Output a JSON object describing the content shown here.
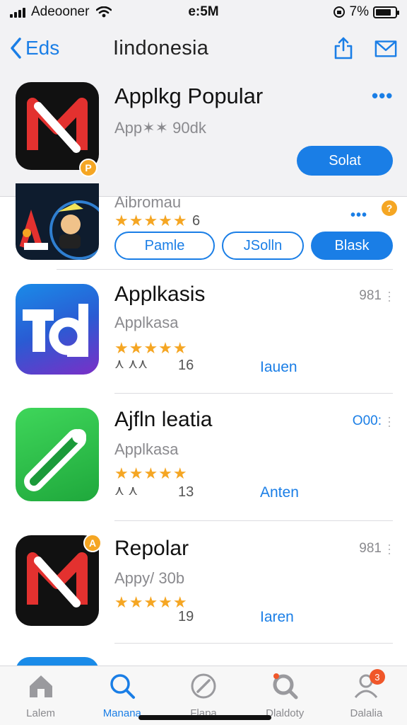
{
  "status": {
    "carrier": "Adeooner",
    "time": "e:5M",
    "battery": "7%",
    "battery_level": 0.8
  },
  "nav": {
    "back_label": "Eds",
    "title": "Iindonesia"
  },
  "featured": {
    "title": "Applkg Popular",
    "subtitle": "App✶✶ 90dk",
    "badge": "P",
    "action_label": "Solat"
  },
  "partial_row": {
    "title": "Aibromau",
    "stars": "★★★★★",
    "count": "6",
    "buttons": [
      "Pamle",
      "JSolln",
      "Blask"
    ],
    "badge": "?"
  },
  "apps": [
    {
      "title": "Applkasis",
      "subtitle": "Applkasa",
      "stars": "★★★★★",
      "meta": "⋏ ⋏⋏",
      "count": "16",
      "link": "Iauen",
      "size": "981"
    },
    {
      "title": "Ajfln leatia",
      "subtitle": "Applkasa",
      "stars": "★★★★★",
      "meta": "⋏ ⋏",
      "count": "13",
      "link": "Anten",
      "size": "O00:"
    },
    {
      "title": "Repolar",
      "subtitle": "Appy/ 30b",
      "stars": "★★★★★",
      "meta": "",
      "count": "19",
      "link": "Iaren",
      "size": "981",
      "badge": "A"
    }
  ],
  "tabs": [
    {
      "label": "Lalem",
      "icon": "home-icon"
    },
    {
      "label": "Manana",
      "icon": "search-icon"
    },
    {
      "label": "Flapa",
      "icon": "compass-icon"
    },
    {
      "label": "Dlaldoty",
      "icon": "discover-icon"
    },
    {
      "label": "Dalalia",
      "icon": "profile-icon",
      "badge": "3"
    }
  ],
  "colors": {
    "accent": "#1a7ee6",
    "star": "#f5a623",
    "badge_orange": "#f5a623",
    "badge_red": "#f0572a"
  }
}
